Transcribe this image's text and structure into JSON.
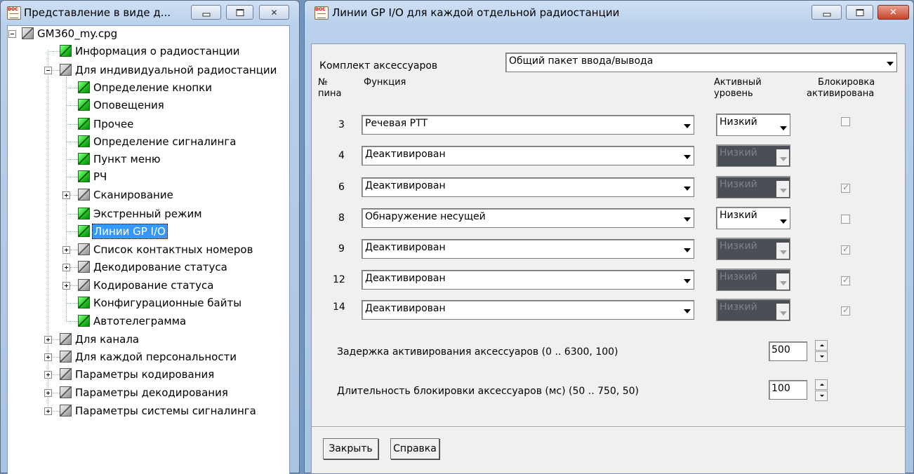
{
  "left_window": {
    "title": "Представление в виде д...",
    "tree": [
      {
        "label": "GM360_my.cpg"
      },
      {
        "label": "Информация о радиостанции"
      },
      {
        "label": "Для индивидуальной радиостанции"
      },
      {
        "label": "Определение кнопки"
      },
      {
        "label": "Оповещения"
      },
      {
        "label": "Прочее"
      },
      {
        "label": "Определение сигналинга"
      },
      {
        "label": "Пункт меню"
      },
      {
        "label": "РЧ"
      },
      {
        "label": "Сканирование"
      },
      {
        "label": "Экстренный режим"
      },
      {
        "label": "Линии GP I/O"
      },
      {
        "label": "Список контактных номеров"
      },
      {
        "label": "Декодирование статуса"
      },
      {
        "label": "Кодирование статуса"
      },
      {
        "label": "Конфигурационные байты"
      },
      {
        "label": "Автотелеграмма"
      },
      {
        "label": "Для канала"
      },
      {
        "label": "Для каждой персональности"
      },
      {
        "label": "Параметры кодирования"
      },
      {
        "label": "Параметры  декодирования"
      },
      {
        "label": "Параметры системы сигналинга"
      }
    ]
  },
  "right_window": {
    "title": "Линии GP I/O для каждой отдельной радиостанции",
    "accessory_label": "Комплект аксессуаров",
    "accessory_value": "Общий пакет ввода/вывода",
    "headers": {
      "pin_1": "№",
      "pin_2": "пина",
      "function": "Функция",
      "level_1": "Активный",
      "level_2": "уровень",
      "lock_1": "Блокировка",
      "lock_2": "активирована"
    },
    "rows": [
      {
        "pin": "3",
        "function": "Речевая PTT",
        "level": "Низкий",
        "level_enabled": true,
        "locked": false,
        "lock_visible": true
      },
      {
        "pin": "4",
        "function": "Деактивирован",
        "level": "Низкий",
        "level_enabled": false,
        "locked": false,
        "lock_visible": false
      },
      {
        "pin": "6",
        "function": "Деактивирован",
        "level": "Низкий",
        "level_enabled": false,
        "locked": true,
        "lock_visible": true
      },
      {
        "pin": "8",
        "function": "Обнаружение несущей",
        "level": "Низкий",
        "level_enabled": true,
        "locked": false,
        "lock_visible": true
      },
      {
        "pin": "9",
        "function": "Деактивирован",
        "level": "Низкий",
        "level_enabled": false,
        "locked": true,
        "lock_visible": true
      },
      {
        "pin": "12",
        "function": "Деактивирован",
        "level": "Низкий",
        "level_enabled": false,
        "locked": true,
        "lock_visible": true
      },
      {
        "pin": "14",
        "function": "Деактивирован",
        "level": "Низкий",
        "level_enabled": false,
        "locked": true,
        "lock_visible": true
      }
    ],
    "delay_label": "Задержка активирования аксессуаров (0 .. 6300, 100)",
    "delay_value": "500",
    "lock_duration_label": "Длительность блокировки аксессуаров (мс) (50 .. 750, 50)",
    "lock_duration_value": "100",
    "close_button": "Закрыть",
    "help_button": "Справка"
  }
}
